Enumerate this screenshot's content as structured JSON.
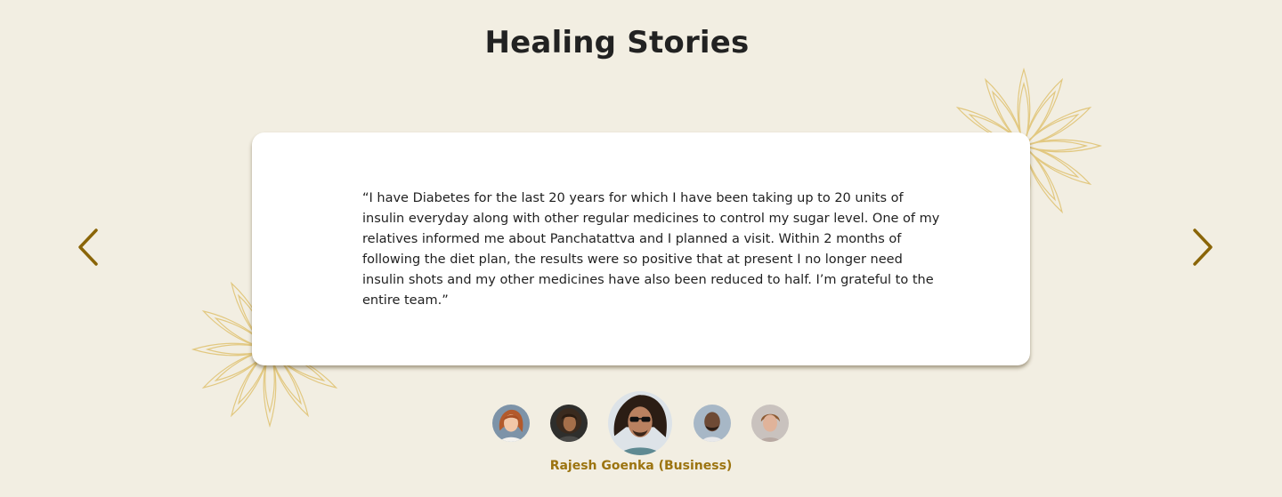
{
  "section": {
    "title": "Healing Stories"
  },
  "testimonial": {
    "quote": "“I have Diabetes for the last 20 years for which I have been taking up to 20 units of insulin everyday along with other regular medicines to control my sugar level. One of my relatives informed me about Panchatattva and I planned a visit. Within 2 months of following the diet plan, the results were so positive that at present I no longer need insulin shots and my other medicines have also been reduced to half. I’m grateful to the entire team.”",
    "author": "Rajesh Goenka (Business)"
  },
  "navigation": {
    "prev_icon": "chevron-left-icon",
    "next_icon": "chevron-right-icon"
  },
  "avatars": [
    {
      "icon": "avatar-woman-red-hair",
      "active": false
    },
    {
      "icon": "avatar-woman-curly-hair",
      "active": false
    },
    {
      "icon": "avatar-man-sunglasses",
      "active": true
    },
    {
      "icon": "avatar-man-bald-beard",
      "active": false
    },
    {
      "icon": "avatar-young-man",
      "active": false
    }
  ],
  "colors": {
    "background": "#f2eee2",
    "card": "#ffffff",
    "accent": "#9c7410",
    "arrow": "#8a6508",
    "title": "#222222",
    "lotus_outline": "#e2c880"
  }
}
